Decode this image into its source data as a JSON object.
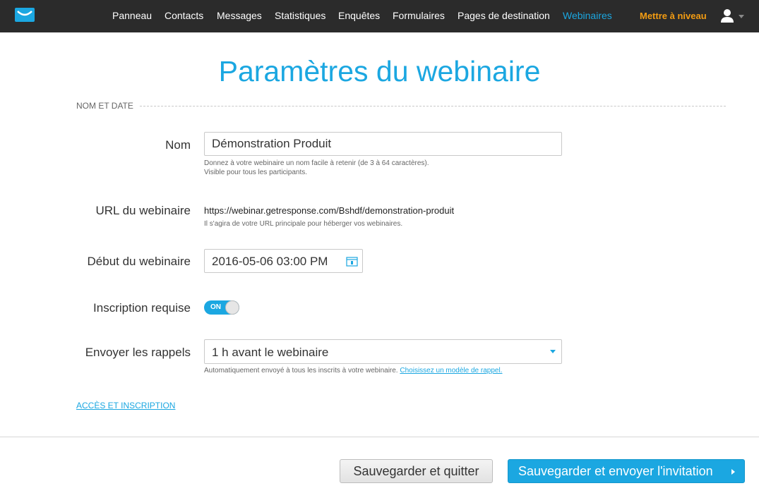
{
  "nav": {
    "items": [
      {
        "label": "Panneau"
      },
      {
        "label": "Contacts"
      },
      {
        "label": "Messages"
      },
      {
        "label": "Statistiques"
      },
      {
        "label": "Enquêtes"
      },
      {
        "label": "Formulaires"
      },
      {
        "label": "Pages de destination"
      },
      {
        "label": "Webinaires",
        "active": true
      }
    ],
    "upgrade_label": "Mettre à niveau",
    "logo_icon": "envelope-logo-icon",
    "user_icon": "user-icon"
  },
  "page": {
    "title": "Paramètres du webinaire",
    "section_label": "NOM ET DATE"
  },
  "form": {
    "name": {
      "label": "Nom",
      "value": "Démonstration Produit",
      "help_line1": "Donnez à votre webinaire un nom facile à retenir (de 3 à 64 caractères).",
      "help_line2": "Visible pour tous les participants."
    },
    "url": {
      "label": "URL du webinaire",
      "value": "https://webinar.getresponse.com/Bshdf/demonstration-produit",
      "help": "Il s'agira de votre URL principale pour héberger vos webinaires."
    },
    "start": {
      "label": "Début du webinaire",
      "value": "2016-05-06 03:00 PM",
      "icon": "calendar-icon"
    },
    "registration": {
      "label": "Inscription requise",
      "toggle_text": "ON",
      "on": true
    },
    "reminders": {
      "label": "Envoyer les rappels",
      "value": "1 h avant le webinaire",
      "help": "Automatiquement envoyé à tous les inscrits à votre webinaire.",
      "help_link": "Choisissez un modèle de rappel."
    }
  },
  "access_link": "ACCÈS ET INSCRIPTION",
  "footer": {
    "save_quit": "Sauvegarder et quitter",
    "save_send": "Sauvegarder et envoyer l'invitation"
  },
  "colors": {
    "accent": "#1ba7e1",
    "upgrade": "#f39c12",
    "topbar": "#2b2b2b"
  }
}
